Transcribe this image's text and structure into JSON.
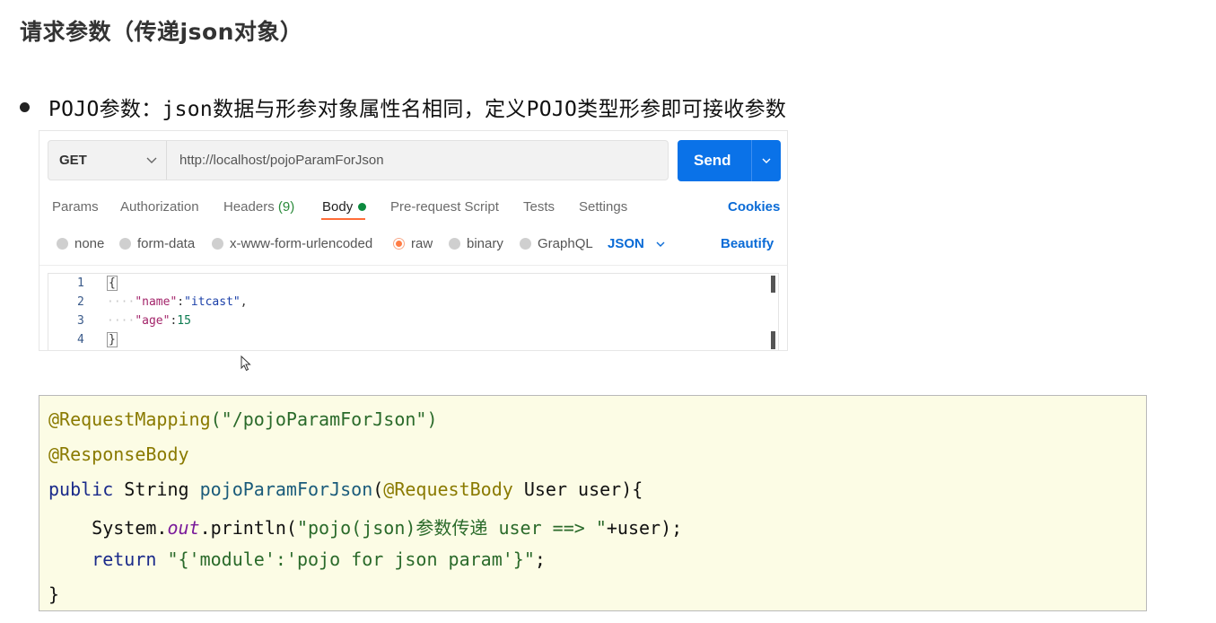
{
  "heading": "请求参数（传递json对象）",
  "bullet": "POJO参数：json数据与形参对象属性名相同，定义POJO类型形参即可接收参数",
  "postman": {
    "method": "GET",
    "url": "http://localhost/pojoParamForJson",
    "send_label": "Send",
    "tabs": [
      {
        "label": "Params"
      },
      {
        "label": "Authorization"
      },
      {
        "label": "Headers",
        "count": "(9)"
      },
      {
        "label": "Body",
        "active": true
      },
      {
        "label": "Pre-request Script"
      },
      {
        "label": "Tests"
      },
      {
        "label": "Settings"
      }
    ],
    "cookies_label": "Cookies",
    "body_options": [
      {
        "label": "none"
      },
      {
        "label": "form-data"
      },
      {
        "label": "x-www-form-urlencoded"
      },
      {
        "label": "raw",
        "selected": true
      },
      {
        "label": "binary"
      },
      {
        "label": "GraphQL"
      }
    ],
    "format": "JSON",
    "beautify_label": "Beautify",
    "editor": {
      "line_numbers": [
        "1",
        "2",
        "3",
        "4"
      ],
      "open_brace": "{",
      "key1": "\"name\"",
      "colon1": ":",
      "val1": "\"itcast\"",
      "comma1": ",",
      "key2": "\"age\"",
      "colon2": ":",
      "val2": "15",
      "close_brace": "}",
      "indent": "····"
    }
  },
  "code": {
    "line1_ann": "@RequestMapping",
    "line1_rest": "(\"/pojoParamForJson\")",
    "line2_ann": "@ResponseBody",
    "line3_kw": "public",
    "line3_a": " String ",
    "line3_fn": "pojoParamForJson",
    "line3_b": "(",
    "line3_ann": "@RequestBody",
    "line3_c": " User user){",
    "line4_a": "    System.",
    "line4_it": "out",
    "line4_b": ".println(",
    "line4_str": "\"pojo(json)参数传递 user ==> \"",
    "line4_c": "+user);",
    "line5_kw": "    return",
    "line5_sp": " ",
    "line5_str": "\"{'module':'pojo for json param'}\"",
    "line5_end": ";",
    "line6": "}"
  },
  "colors": {
    "send": "#0a72e8",
    "active_tab_underline": "#ff6c37",
    "link_blue": "#0a6bd6",
    "code_bg": "#fcfce5"
  }
}
